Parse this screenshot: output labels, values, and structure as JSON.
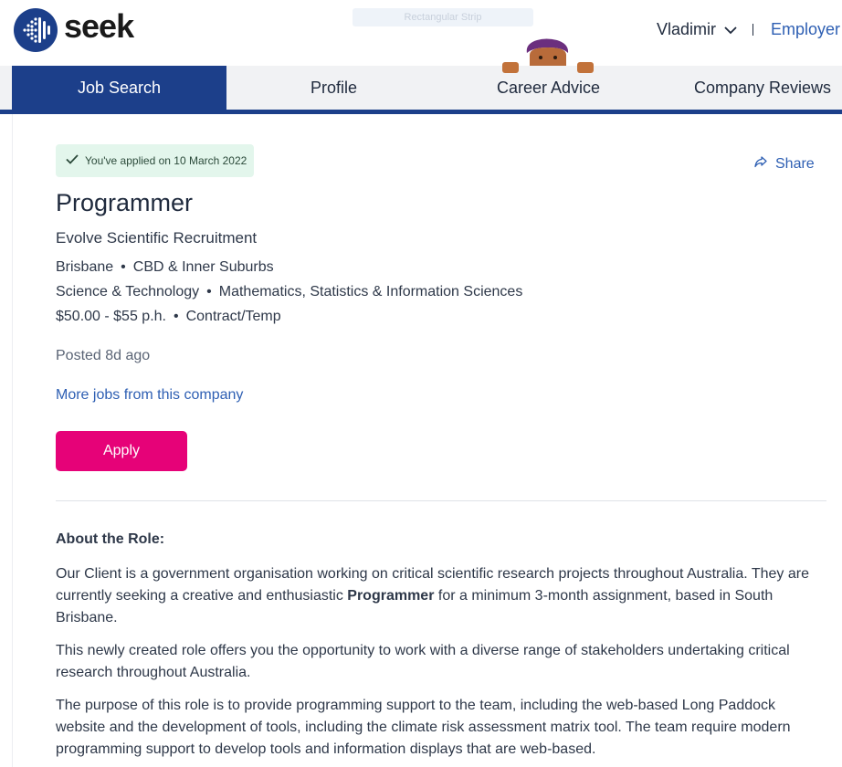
{
  "header": {
    "logo_text": "seek",
    "ad_strip_text": "Rectangular Strip",
    "user_name": "Vladimir",
    "employer_label": "Employer"
  },
  "nav": {
    "tabs": [
      {
        "label": "Job Search",
        "active": true
      },
      {
        "label": "Profile",
        "active": false
      },
      {
        "label": "Career Advice",
        "active": false
      },
      {
        "label": "Company Reviews",
        "active": false
      }
    ]
  },
  "job": {
    "applied_text": "You've applied on 10 March 2022",
    "share_label": "Share",
    "title": "Programmer",
    "company": "Evolve Scientific Recruitment",
    "location": "Brisbane",
    "area": "CBD & Inner Suburbs",
    "classification": "Science & Technology",
    "sub_classification": "Mathematics, Statistics & Information Sciences",
    "salary": "$50.00 - $55 p.h.",
    "work_type": "Contract/Temp",
    "posted": "Posted 8d ago",
    "more_jobs_label": "More jobs from this company",
    "apply_label": "Apply"
  },
  "description": {
    "heading": "About the Role:",
    "p1_before": "Our Client is a government organisation working on critical scientific research projects throughout Australia. They are currently seeking a creative and enthusiastic ",
    "p1_bold": "Programmer",
    "p1_after": " for a minimum 3-month assignment, based in South Brisbane.",
    "p2": "This newly created role offers you the opportunity to work with a diverse range of stakeholders undertaking critical research throughout Australia.",
    "p3": "The purpose of this role is to provide programming support to the team, including the web-based Long Paddock website and the development of tools, including the climate risk assessment matrix tool. The team require modern programming support to develop tools and information displays that are web-based."
  },
  "colors": {
    "brand_blue": "#1c3f8a",
    "link_blue": "#2e5fb3",
    "apply_pink": "#e60278",
    "applied_green_bg": "#e3f6ec"
  }
}
